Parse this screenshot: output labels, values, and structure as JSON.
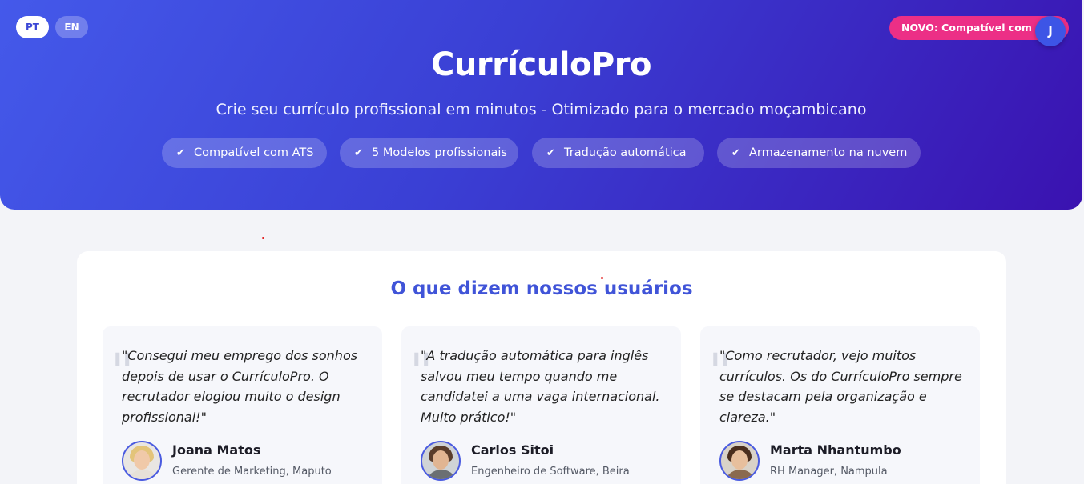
{
  "language_switch": {
    "pt_label": "PT",
    "en_label": "EN",
    "selected": "PT"
  },
  "header": {
    "badge": "NOVO: Compatível com ATS",
    "user_initial": "J",
    "title": "CurrículoPro",
    "subtitle": "Crie seu currículo profissional em minutos - Otimizado para o mercado moçambicano",
    "features": [
      {
        "icon": "check-icon",
        "label": "Compatível com ATS"
      },
      {
        "icon": "check-icon",
        "label": "5 Modelos profissionais"
      },
      {
        "icon": "check-icon",
        "label": "Tradução automática"
      },
      {
        "icon": "check-icon",
        "label": "Armazenamento na nuvem"
      }
    ]
  },
  "testimonials": {
    "title": "O que dizem nossos usuários",
    "items": [
      {
        "quote": "\"Consegui meu emprego dos sonhos depois de usar o CurrículoPro. O recrutador elogiou muito o design profissional!\"",
        "name": "Joana Matos",
        "role": "Gerente de Marketing, Maputo"
      },
      {
        "quote": "\"A tradução automática para inglês salvou meu tempo quando me candidatei a uma vaga internacional. Muito prático!\"",
        "name": "Carlos Sitoi",
        "role": "Engenheiro de Software, Beira"
      },
      {
        "quote": "\"Como recrutador, vejo muitos currículos. Os do CurrículoPro sempre se destacam pela organização e clareza.\"",
        "name": "Marta Nhantumbo",
        "role": "RH Manager, Nampula"
      }
    ]
  },
  "colors": {
    "hero_gradient_start": "#4459ea",
    "hero_gradient_end": "#3a12b0",
    "badge": "#ec2f86",
    "accent": "#4054d8"
  }
}
